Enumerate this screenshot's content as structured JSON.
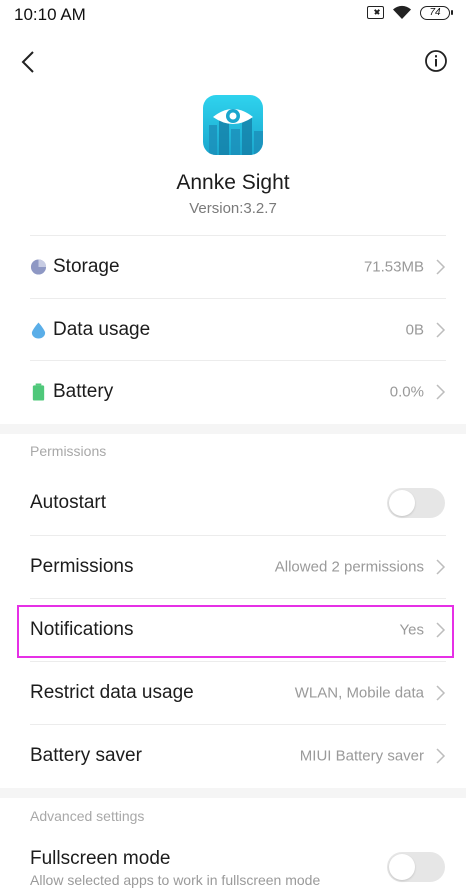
{
  "status_bar": {
    "time": "10:10 AM",
    "battery": "74",
    "icons": [
      "no-sim-icon",
      "wifi-icon",
      "battery-icon"
    ]
  },
  "top_bar": {
    "back_icon": "chevron-left-icon",
    "info_icon": "info-icon"
  },
  "app": {
    "name": "Annke Sight",
    "version": "Version:3.2.7",
    "icon": "annke-sight-app-icon"
  },
  "usage_rows": [
    {
      "label": "Storage",
      "value": "71.53MB",
      "icon": "pie-chart-icon",
      "icon_color": "#8e98c4"
    },
    {
      "label": "Data usage",
      "value": "0B",
      "icon": "water-drop-icon",
      "icon_color": "#5aaee8"
    },
    {
      "label": "Battery",
      "value": "0.0%",
      "icon": "battery-level-icon",
      "icon_color": "#4fc87a"
    }
  ],
  "permissions_section": {
    "title": "Permissions",
    "autostart": {
      "label": "Autostart",
      "enabled": false
    },
    "rows": [
      {
        "label": "Permissions",
        "value": "Allowed 2 permissions"
      },
      {
        "label": "Notifications",
        "value": "Yes"
      },
      {
        "label": "Restrict data usage",
        "value": "WLAN, Mobile data"
      },
      {
        "label": "Battery saver",
        "value": "MIUI Battery saver"
      }
    ]
  },
  "advanced_section": {
    "title": "Advanced settings",
    "fullscreen": {
      "label": "Fullscreen mode",
      "sublabel": "Allow selected apps to work in fullscreen mode",
      "enabled": false
    }
  },
  "colors": {
    "highlight": "#e630e6",
    "toggle_off": "#e6e6e6"
  }
}
